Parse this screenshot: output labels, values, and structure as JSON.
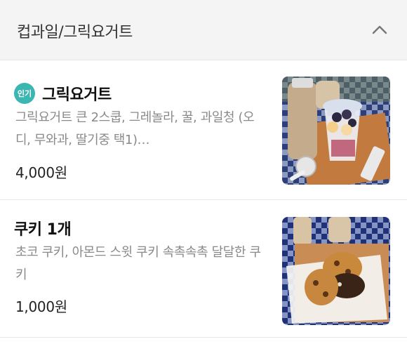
{
  "section": {
    "title": "컵과일/그릭요거트",
    "collapse_icon": "chevron-up-icon"
  },
  "items": [
    {
      "badge": "인기",
      "name": "그릭요거트",
      "description": "그릭요거트 큰 2스쿱, 그레놀라, 꿀, 과일청 (오디, 무와과, 딸기중 택1)…",
      "price": "4,000원"
    },
    {
      "name": "쿠키 1개",
      "description": "초코 쿠키, 아몬드 스윗 쿠키 속촉속촉 달달한 쿠키",
      "price": "1,000원"
    }
  ],
  "colors": {
    "badge": "#3cb6b0",
    "header_bg": "#f4f4f4",
    "desc_text": "#8a8a8a"
  }
}
